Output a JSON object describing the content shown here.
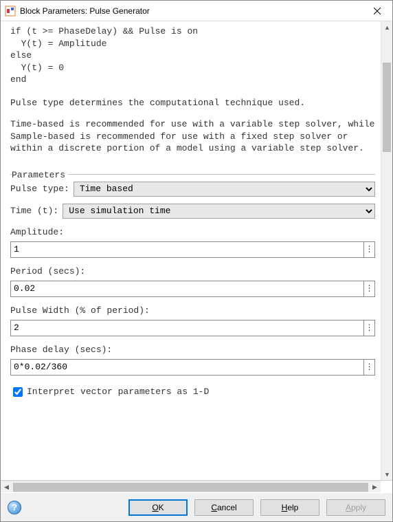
{
  "window": {
    "title": "Block Parameters: Pulse Generator"
  },
  "code": "if (t >= PhaseDelay) && Pulse is on\n  Y(t) = Amplitude\nelse\n  Y(t) = 0\nend",
  "desc1": "Pulse type determines the computational technique used.",
  "desc2": "Time-based is recommended for use with a variable step solver, while Sample-based is recommended for use with a fixed step solver or within a discrete portion of a model using a variable step solver.",
  "parameters": {
    "legend": "Parameters",
    "pulse_type": {
      "label": "Pulse type:",
      "value": "Time based"
    },
    "time": {
      "label": "Time (t):",
      "value": "Use simulation time"
    },
    "amplitude": {
      "label": "Amplitude:",
      "value": "1"
    },
    "period": {
      "label": "Period (secs):",
      "value": "0.02"
    },
    "pulse_width": {
      "label": "Pulse Width (% of period):",
      "value": "2"
    },
    "phase_delay": {
      "label": "Phase delay (secs):",
      "value": "0*0.02/360"
    },
    "interpret_1d": {
      "label": "Interpret vector parameters as 1-D",
      "checked": true
    }
  },
  "buttons": {
    "ok": "OK",
    "cancel": "Cancel",
    "help": "Help",
    "apply": "Apply"
  }
}
